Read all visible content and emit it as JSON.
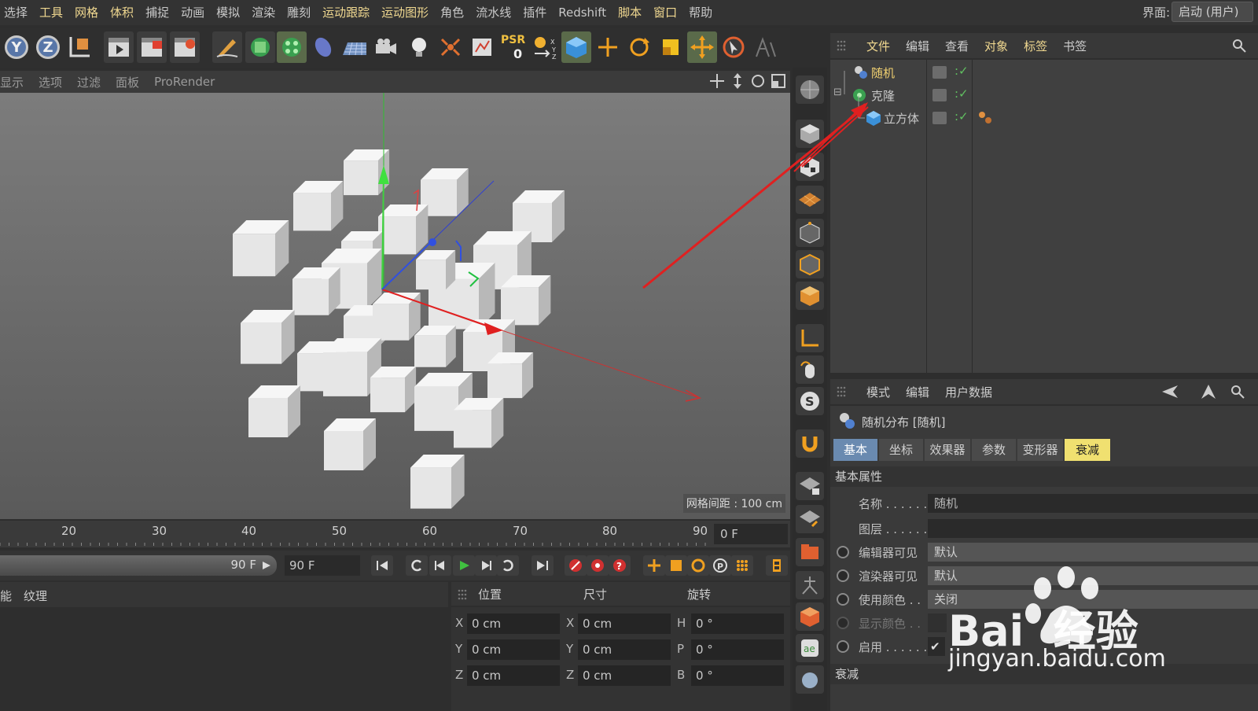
{
  "menubar": {
    "items": [
      {
        "label": "选择",
        "yellow": false
      },
      {
        "label": "工具",
        "yellow": true
      },
      {
        "label": "网格",
        "yellow": true
      },
      {
        "label": "体积",
        "yellow": true
      },
      {
        "label": "捕捉",
        "yellow": false
      },
      {
        "label": "动画",
        "yellow": false
      },
      {
        "label": "模拟",
        "yellow": false
      },
      {
        "label": "渲染",
        "yellow": false
      },
      {
        "label": "雕刻",
        "yellow": false
      },
      {
        "label": "运动跟踪",
        "yellow": true
      },
      {
        "label": "运动图形",
        "yellow": true
      },
      {
        "label": "角色",
        "yellow": false
      },
      {
        "label": "流水线",
        "yellow": false
      },
      {
        "label": "插件",
        "yellow": false
      },
      {
        "label": "Redshift",
        "yellow": false
      },
      {
        "label": "脚本",
        "yellow": true
      },
      {
        "label": "窗口",
        "yellow": true
      },
      {
        "label": "帮助",
        "yellow": false
      }
    ],
    "layout_label": "界面:",
    "layout_value": "启动 (用户)"
  },
  "toolbar": {
    "y_axis": "Y",
    "z_axis": "Z",
    "psr_label": "PSR",
    "psr_value": "0"
  },
  "viewport": {
    "menu": [
      "显示",
      "选项",
      "过滤",
      "面板",
      "ProRender"
    ],
    "grid_spacing": "网格间距 : 100 cm"
  },
  "object_manager": {
    "menu": [
      {
        "label": "文件",
        "yellow": true
      },
      {
        "label": "编辑",
        "yellow": false
      },
      {
        "label": "查看",
        "yellow": false
      },
      {
        "label": "对象",
        "yellow": true
      },
      {
        "label": "标签",
        "yellow": true
      },
      {
        "label": "书签",
        "yellow": false
      }
    ],
    "objects": [
      {
        "name": "随机",
        "color": "#f0d070",
        "indent": 0
      },
      {
        "name": "克隆",
        "color": "#c8c8c8",
        "indent": 0
      },
      {
        "name": "立方体",
        "color": "#c8c8c8",
        "indent": 1
      }
    ]
  },
  "attribute_manager": {
    "menu": [
      "模式",
      "编辑",
      "用户数据"
    ],
    "title": "随机分布 [随机]",
    "tabs": [
      {
        "label": "基本",
        "state": "active"
      },
      {
        "label": "坐标",
        "state": ""
      },
      {
        "label": "效果器",
        "state": ""
      },
      {
        "label": "参数",
        "state": ""
      },
      {
        "label": "变形器",
        "state": ""
      },
      {
        "label": "衰减",
        "state": "hl"
      }
    ],
    "section_basic": "基本属性",
    "props": {
      "name_label": "名称 . . . . . .",
      "name_value": "随机",
      "layer_label": "图层 . . . . . .",
      "layer_value": "",
      "editor_vis_label": "编辑器可见",
      "editor_vis_value": "默认",
      "render_vis_label": "渲染器可见",
      "render_vis_value": "默认",
      "use_color_label": "使用颜色 . .",
      "use_color_value": "关闭",
      "display_color_label": "显示颜色 . .",
      "enabled_label": "启用 . . . . . .",
      "enabled_check": "✔"
    },
    "section_falloff": "衰减"
  },
  "timeline": {
    "ticks": [
      "20",
      "30",
      "40",
      "50",
      "60",
      "70",
      "80",
      "90"
    ],
    "current_frame": "0 F",
    "slider_value": "90 F",
    "end_frame": "90 F"
  },
  "materials": {
    "tab_cut": "能",
    "tab_texture": "纹理"
  },
  "coordinates": {
    "headers": [
      "位置",
      "尺寸",
      "旋转"
    ],
    "rows": [
      {
        "pos_axis": "X",
        "pos": "0 cm",
        "size_axis": "X",
        "size": "0 cm",
        "rot_axis": "H",
        "rot": "0 °"
      },
      {
        "pos_axis": "Y",
        "pos": "0 cm",
        "size_axis": "Y",
        "size": "0 cm",
        "rot_axis": "P",
        "rot": "0 °"
      },
      {
        "pos_axis": "Z",
        "pos": "0 cm",
        "size_axis": "Z",
        "size": "0 cm",
        "rot_axis": "B",
        "rot": "0 °"
      }
    ]
  },
  "watermark": {
    "brand": "Bai  经验",
    "url": "jingyan.baidu.com"
  }
}
